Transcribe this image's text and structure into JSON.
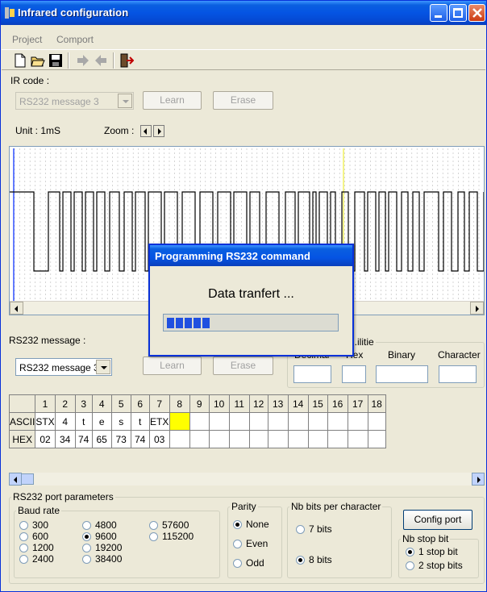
{
  "window": {
    "title": "Infrared configuration"
  },
  "menu": [
    "Project",
    "Comport"
  ],
  "ir": {
    "label": "IR code :",
    "combo_value": "RS232 message 3",
    "learn": "Learn",
    "erase": "Erase",
    "unit": "Unit : 1mS",
    "zoom": "Zoom :"
  },
  "dialog": {
    "title": "Programming RS232 command",
    "message": "Data tranfert ...",
    "progress": 0.25
  },
  "rs232": {
    "label": "RS232 message :",
    "combo_value": "RS232 message 3",
    "learn": "Learn",
    "erase": "Erase",
    "edit_group_title": "...ilitie",
    "edit_headers": [
      "Decimal",
      "Hex",
      "Binary",
      "Character"
    ]
  },
  "grid": {
    "columns": [
      "1",
      "2",
      "3",
      "4",
      "5",
      "6",
      "7",
      "8",
      "9",
      "10",
      "11",
      "12",
      "13",
      "14",
      "15",
      "16",
      "17",
      "18"
    ],
    "ascii_label": "ASCII",
    "hex_label": "HEX",
    "ascii": [
      "STX",
      "4",
      "t",
      "e",
      "s",
      "t",
      "ETX",
      "",
      "",
      "",
      "",
      "",
      "",
      "",
      "",
      "",
      "",
      ""
    ],
    "hex": [
      "02",
      "34",
      "74",
      "65",
      "73",
      "74",
      "03",
      "",
      "",
      "",
      "",
      "",
      "",
      "",
      "",
      "",
      "",
      ""
    ],
    "highlight_col": 8
  },
  "port": {
    "title": "RS232 port parameters",
    "baud_title": "Baud rate",
    "baud_rates": [
      "300",
      "600",
      "1200",
      "2400",
      "4800",
      "9600",
      "19200",
      "38400",
      "57600",
      "115200"
    ],
    "baud_selected": "9600",
    "parity_title": "Parity",
    "parity": [
      "None",
      "Even",
      "Odd"
    ],
    "parity_selected": "None",
    "nbits_title": "Nb bits per character",
    "nbits": [
      "7 bits",
      "8 bits"
    ],
    "nbits_selected": "8 bits",
    "config_button": "Config port",
    "stop_title": "Nb stop bit",
    "stop": [
      "1 stop bit",
      "2 stop bits"
    ],
    "stop_selected": "1 stop bit"
  },
  "colors": {
    "accent": "#0554e3",
    "highlight": "#ffff00",
    "waveform": "#000000",
    "marker": "#3050ff"
  },
  "waveform": {
    "levels": [
      0,
      1,
      0,
      1,
      0,
      1,
      0,
      1,
      0,
      1,
      0,
      1,
      0,
      1,
      0,
      1,
      0,
      1,
      0,
      1,
      0,
      1,
      0,
      1,
      0,
      1,
      0,
      1,
      0,
      1,
      0,
      1,
      0,
      1,
      0,
      1,
      0,
      1,
      0,
      1,
      0,
      1,
      0,
      1,
      0,
      1,
      0,
      1,
      0,
      1,
      0,
      1,
      0,
      1,
      0,
      1,
      0,
      1,
      0,
      1,
      0,
      1,
      0,
      1,
      0,
      1,
      0,
      1,
      0,
      1
    ]
  }
}
